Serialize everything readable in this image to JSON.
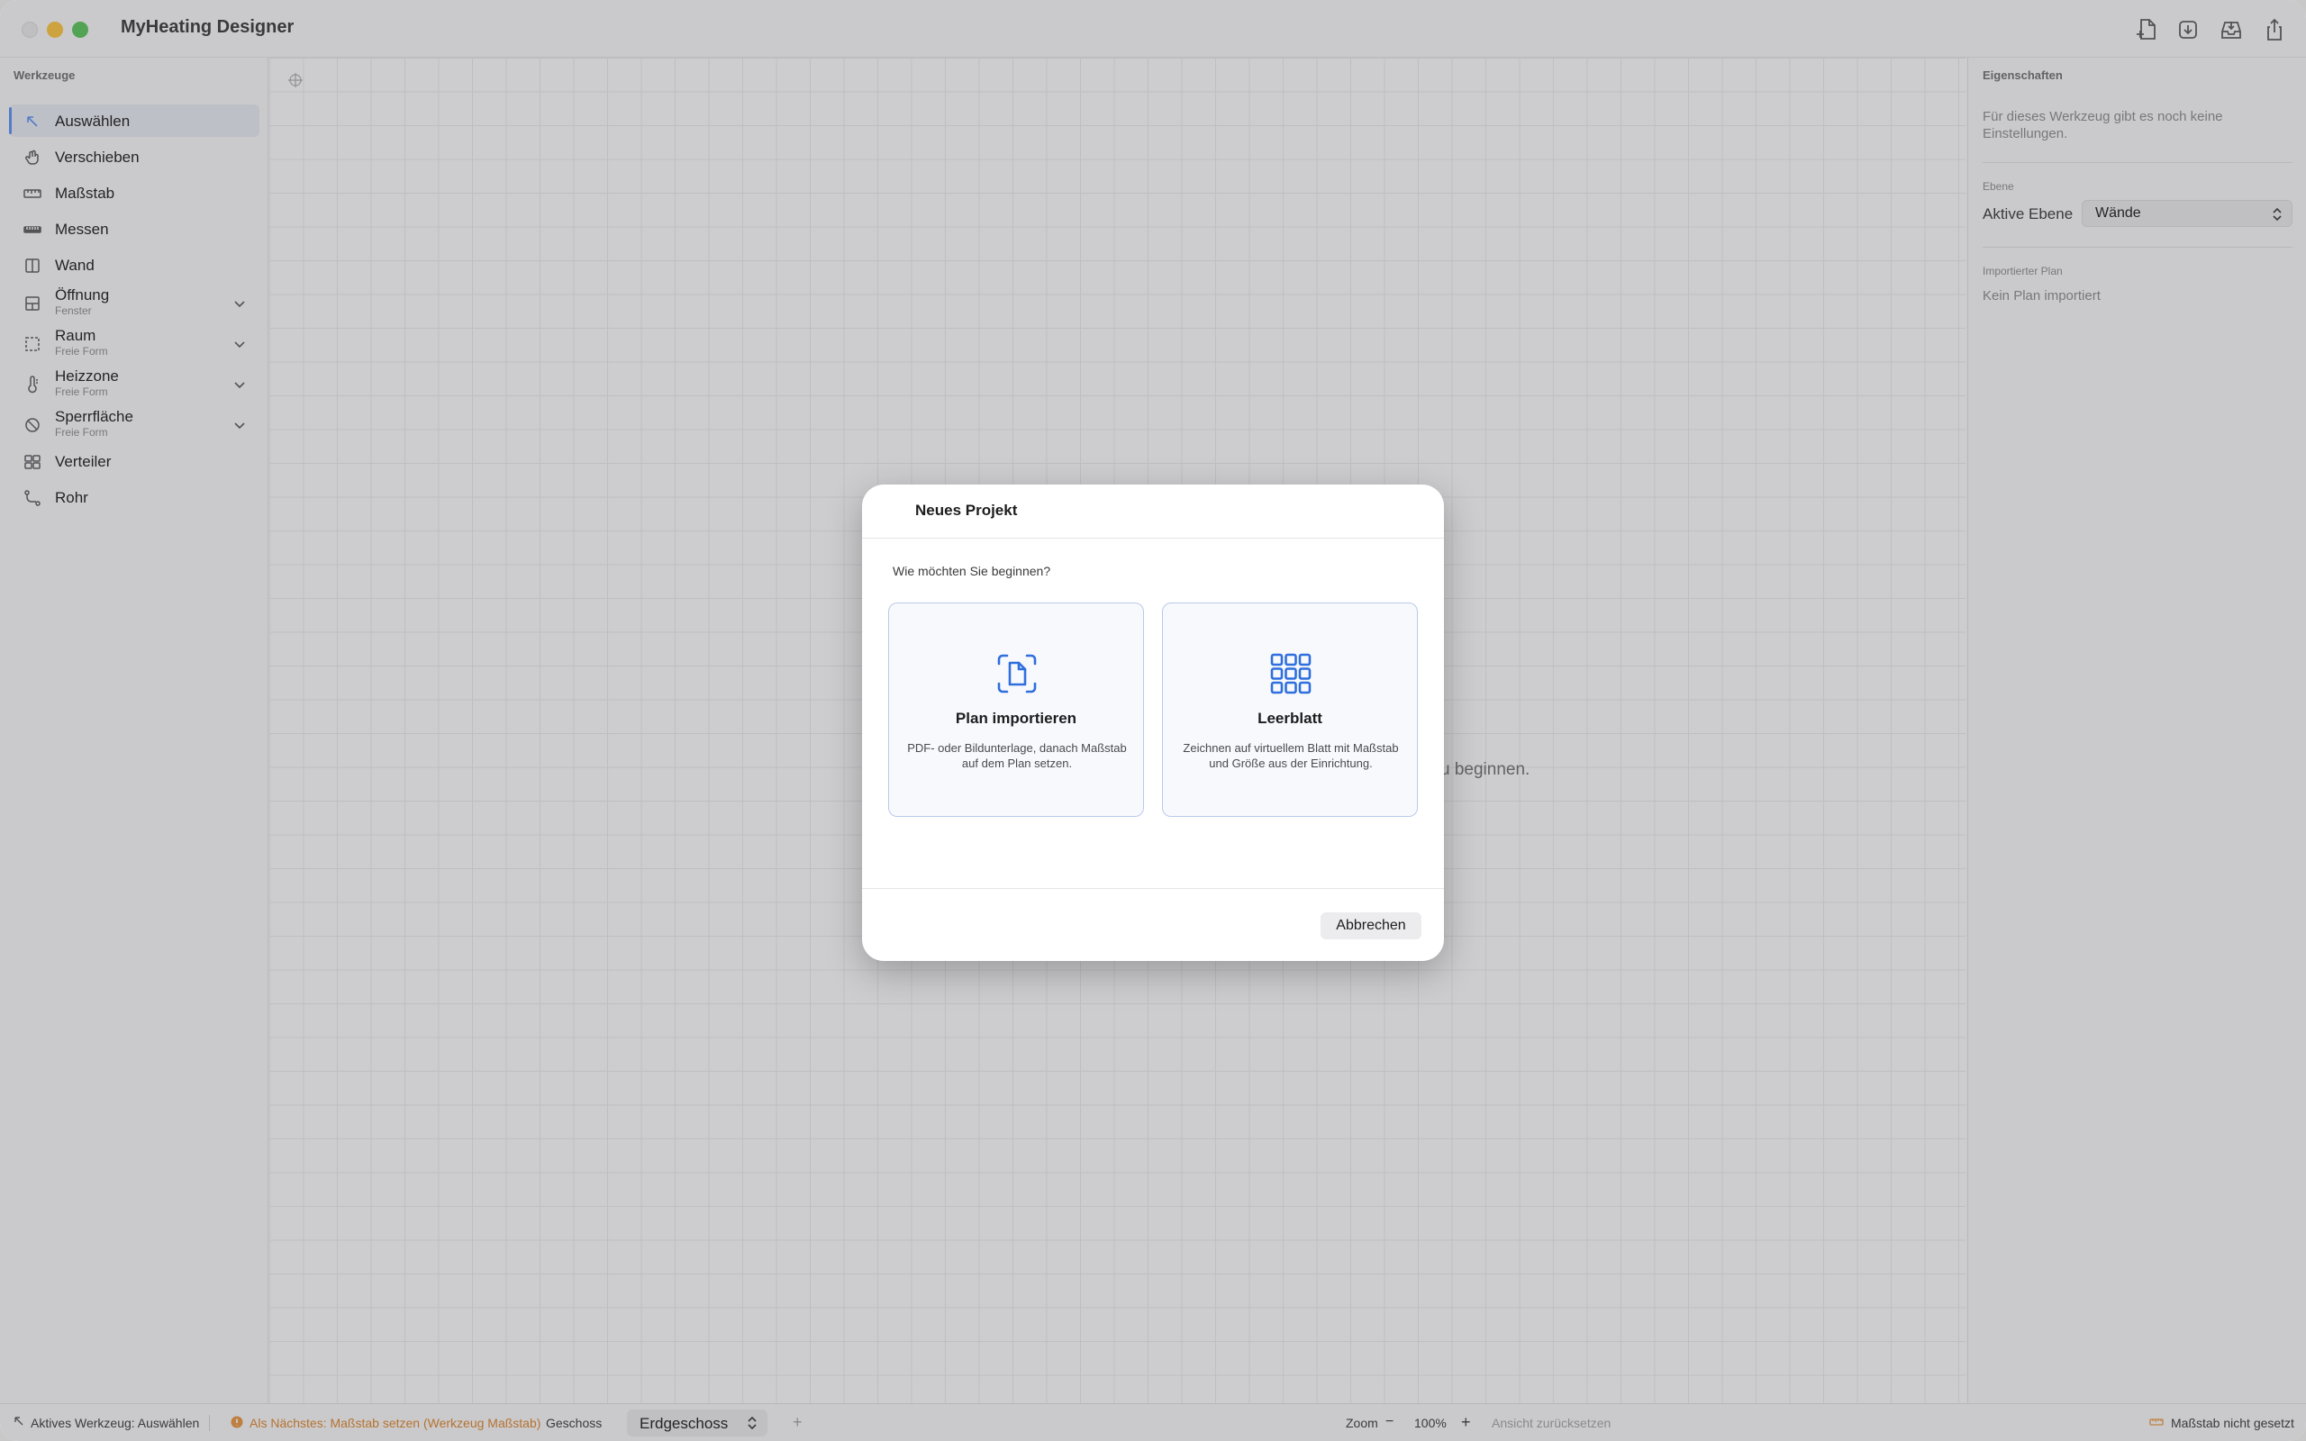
{
  "app": {
    "title": "MyHeating Designer"
  },
  "sidebar": {
    "header": "Werkzeuge",
    "tools": [
      {
        "label": "Auswählen",
        "icon": "cursor-arrow-icon",
        "active": true
      },
      {
        "label": "Verschieben",
        "icon": "move-hand-icon"
      },
      {
        "label": "Maßstab",
        "icon": "ruler-icon"
      },
      {
        "label": "Messen",
        "icon": "measure-icon"
      },
      {
        "label": "Wand",
        "icon": "wall-icon"
      },
      {
        "label": "Öffnung",
        "sub": "Fenster",
        "icon": "opening-icon",
        "expandable": true
      },
      {
        "label": "Raum",
        "sub": "Freie Form",
        "icon": "room-icon",
        "expandable": true
      },
      {
        "label": "Heizzone",
        "sub": "Freie Form",
        "icon": "thermometer-icon",
        "expandable": true
      },
      {
        "label": "Sperrfläche",
        "sub": "Freie Form",
        "icon": "no-entry-icon",
        "expandable": true
      },
      {
        "label": "Verteiler",
        "icon": "manifold-icon"
      },
      {
        "label": "Rohr",
        "icon": "pipe-icon"
      }
    ]
  },
  "canvas": {
    "hint_visible": "u beginnen."
  },
  "panel": {
    "header": "Eigenschaften",
    "note": "Für dieses Werkzeug gibt es noch keine Einstellungen.",
    "layer_section": "Ebene",
    "layer_label": "Aktive Ebene",
    "layer_value": "Wände",
    "import_section": "Importierter Plan",
    "import_value": "Kein Plan importiert"
  },
  "statusbar": {
    "active_tool": "Aktives Werkzeug: Auswählen",
    "next_step": "Als Nächstes: Maßstab setzen (Werkzeug Maßstab)",
    "floor_label": "Geschoss",
    "floor_value": "Erdgeschoss",
    "add_floor": "+",
    "zoom_label": "Zoom",
    "zoom_minus": "−",
    "zoom_value": "100%",
    "zoom_plus": "+",
    "reset_view": "Ansicht zurücksetzen",
    "scale_status": "Maßstab nicht gesetzt"
  },
  "modal": {
    "title": "Neues Projekt",
    "question": "Wie möchten Sie beginnen?",
    "options": [
      {
        "title": "Plan importieren",
        "description": "PDF- oder Bildunterlage, danach Maßstab auf dem Plan setzen.",
        "icon": "import-document-icon"
      },
      {
        "title": "Leerblatt",
        "description": "Zeichnen auf virtuellem Blatt mit Maßstab und Größe aus der Einrichtung.",
        "icon": "grid-icon"
      }
    ],
    "cancel_label": "Abbrechen"
  },
  "colors": {
    "accent": "#2f6fde",
    "warning": "#d9822b",
    "selection_bar": "#5b8dee"
  }
}
